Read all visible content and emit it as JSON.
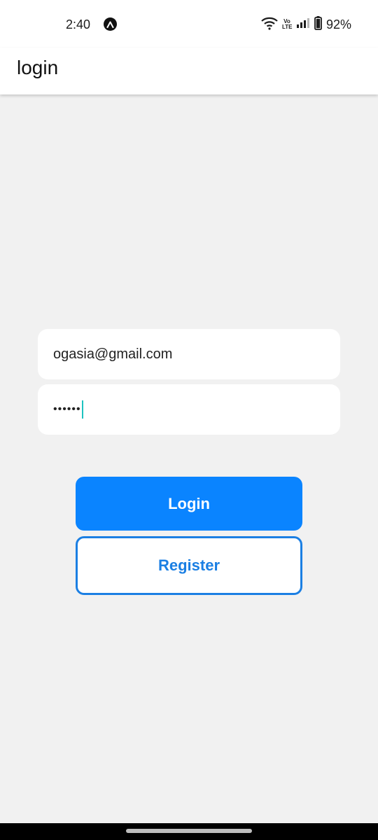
{
  "status_bar": {
    "time": "2:40",
    "notification_icon": "navigation-arrow-icon",
    "network_label_top": "Vo",
    "network_label_bottom": "LTE",
    "battery": "92%"
  },
  "app_bar": {
    "title": "login"
  },
  "form": {
    "email_value": "ogasia@gmail.com",
    "password_mask": "••••••"
  },
  "buttons": {
    "login_label": "Login",
    "register_label": "Register"
  },
  "colors": {
    "primary": "#0a84ff",
    "register_border": "#1b7fe3",
    "background": "#f1f1f1",
    "caret": "#1ec3c0"
  }
}
